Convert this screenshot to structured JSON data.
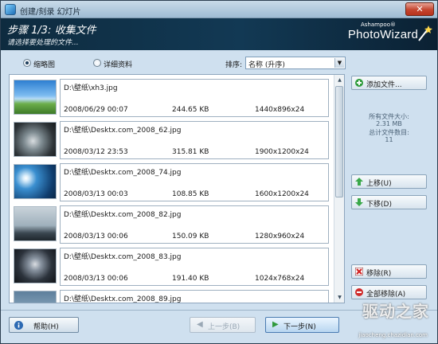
{
  "window": {
    "title": "创建/刻录 幻灯片",
    "close_glyph": "✕"
  },
  "header": {
    "step_title": "步骤 1/3: 收集文件",
    "step_subtitle": "请选择要处理的文件...",
    "brand_small": "Ashampoo®",
    "brand_big": "PhotoWizard"
  },
  "view": {
    "thumbnails_label": "缩略图",
    "details_label": "详细资料",
    "selected": "thumbnails",
    "sort_label": "排序:",
    "sort_value": "名称 (升序)"
  },
  "files": [
    {
      "path": "D:\\壁纸\\xh3.jpg",
      "date": "2008/06/29 00:07",
      "size": "244.65 KB",
      "dims": "1440x896x24"
    },
    {
      "path": "D:\\壁纸\\Desktx.com_2008_62.jpg",
      "date": "2008/03/12 23:53",
      "size": "315.81 KB",
      "dims": "1900x1200x24"
    },
    {
      "path": "D:\\壁纸\\Desktx.com_2008_74.jpg",
      "date": "2008/03/13 00:03",
      "size": "108.85 KB",
      "dims": "1600x1200x24"
    },
    {
      "path": "D:\\壁纸\\Desktx.com_2008_82.jpg",
      "date": "2008/03/13 00:06",
      "size": "150.09 KB",
      "dims": "1280x960x24"
    },
    {
      "path": "D:\\壁纸\\Desktx.com_2008_83.jpg",
      "date": "2008/03/13 00:06",
      "size": "191.40 KB",
      "dims": "1024x768x24"
    },
    {
      "path": "D:\\壁纸\\Desktx.com_2008_89.jpg",
      "date": "",
      "size": "",
      "dims": ""
    }
  ],
  "panel": {
    "add_files": "添加文件...",
    "total_size_label": "所有文件大小:",
    "total_size": "2.31 MB",
    "total_count_label": "总计文件数目:",
    "total_count": "11",
    "move_up": "上移(U)",
    "move_down": "下移(D)",
    "remove": "移除(R)",
    "remove_all": "全部移除(A)"
  },
  "footer": {
    "help": "帮助(H)",
    "back": "上一步(B)",
    "next": "下一步(N)"
  },
  "watermark": {
    "big": "驱动之家",
    "small": "jiaocheng.chazidian.com"
  }
}
